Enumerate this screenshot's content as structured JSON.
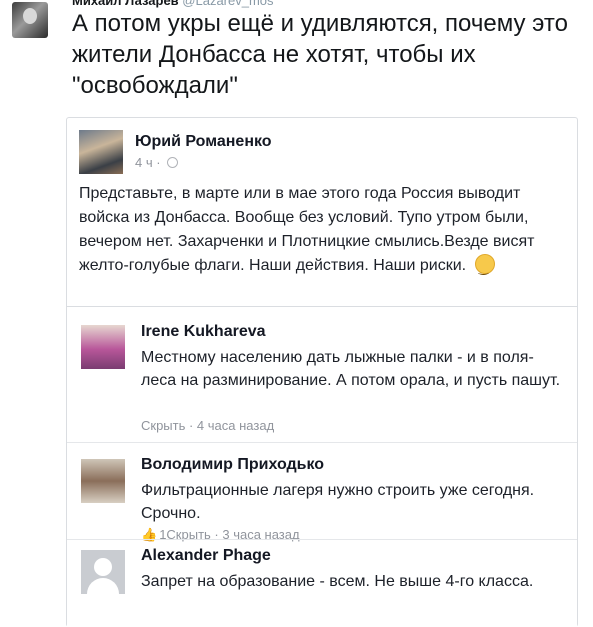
{
  "tweet": {
    "author_cut": "Михаил Лазарев",
    "handle_cut": "@Lazarev_mos",
    "text": "А потом укры ещё и удивляются, почему это жители Донбасса не хотят, чтобы их \"освобождали\""
  },
  "post": {
    "author": "Юрий Романенко",
    "time": "4 ч ·",
    "globe_icon": "globe-icon",
    "body": "Представьте, в марте или в мае этого года Россия выводит войска из Донбасса. Вообще без условий. Тупо утром были, вечером нет. Захарченки и Плотницкие смылись.Везде висят желто-голубые флаги. Наши действия. Наши риски."
  },
  "comments": [
    {
      "name": "Irene Kukhareva",
      "text": "Местному населению дать лыжные палки - и в поля-леса на разминирование. А потом орала, и пусть пашут.",
      "meta": "Скрыть · 4 часа назад"
    },
    {
      "name": "Володимир Приходько",
      "text": "Фильтрационные лагеря нужно строить уже сегодня. Срочно.",
      "likes": "1",
      "meta": "Скрыть · 3 часа назад"
    },
    {
      "name": "Alexander Phage",
      "text": "Запрет на образование - всем. Не выше 4-го класса."
    }
  ]
}
